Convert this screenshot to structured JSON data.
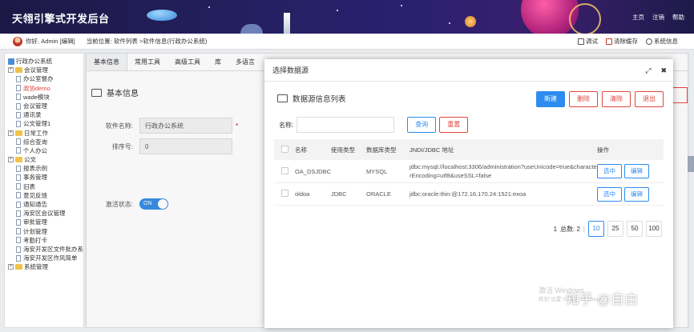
{
  "app": {
    "title": "天翎引擎式开发后台"
  },
  "top_links": [
    "主页",
    "注销",
    "帮助"
  ],
  "crumb": {
    "greeting": "你好, Admin [编辑]",
    "location": "当前位置: 软件列表 >软件信息(行政办公系统)",
    "tools": [
      "调试",
      "清除缓存",
      "系统信息"
    ]
  },
  "sidebar": {
    "root": "行政办公系统",
    "items": [
      {
        "label": "会议管理",
        "type": "folder",
        "level": 1
      },
      {
        "label": "办公室督办",
        "type": "doc",
        "level": 2
      },
      {
        "label": "政协demo",
        "type": "doc",
        "level": 2,
        "active": true
      },
      {
        "label": "wade模块",
        "type": "doc",
        "level": 2
      },
      {
        "label": "会议管理",
        "type": "doc",
        "level": 2
      },
      {
        "label": "通讯录",
        "type": "doc",
        "level": 2
      },
      {
        "label": "公文管理1",
        "type": "doc",
        "level": 2
      },
      {
        "label": "日常工作",
        "type": "folder",
        "level": 1
      },
      {
        "label": "综合查询",
        "type": "doc",
        "level": 2
      },
      {
        "label": "个人办公",
        "type": "doc",
        "level": 2
      },
      {
        "label": "公文",
        "type": "folder",
        "level": 1
      },
      {
        "label": "报表示例",
        "type": "doc",
        "level": 2
      },
      {
        "label": "事务管理",
        "type": "doc",
        "level": 2
      },
      {
        "label": "旧表",
        "type": "doc",
        "level": 2
      },
      {
        "label": "意见反馈",
        "type": "doc",
        "level": 2
      },
      {
        "label": "通知通告",
        "type": "doc",
        "level": 2
      },
      {
        "label": "海安区会议管理",
        "type": "doc",
        "level": 2
      },
      {
        "label": "审批管理",
        "type": "doc",
        "level": 2
      },
      {
        "label": "计划管理",
        "type": "doc",
        "level": 2
      },
      {
        "label": "考勤打卡",
        "type": "doc",
        "level": 2
      },
      {
        "label": "海安开发区文件批办系",
        "type": "doc",
        "level": 2
      },
      {
        "label": "海安开发区作风简单",
        "type": "doc",
        "level": 2
      },
      {
        "label": "系统管理",
        "type": "folder",
        "level": 1
      }
    ]
  },
  "main": {
    "tabs": [
      "基本信息",
      "常用工具",
      "高级工具",
      "库",
      "多语言"
    ],
    "section_title": "基本信息",
    "fields": {
      "name_label": "软件名称:",
      "name_value": "行政办公系统",
      "order_label": "排序号:",
      "order_value": "0",
      "active_label": "激活状态:",
      "active_value": "ON",
      "required_mark": "*"
    }
  },
  "modal": {
    "title": "选择数据源",
    "ctrl_max": "⤢",
    "ctrl_close": "✖",
    "list_title": "数据源信息列表",
    "buttons": {
      "new": "新建",
      "delete": "删除",
      "clear": "清除",
      "exit": "退出"
    },
    "search": {
      "label": "名称:",
      "query": "查询",
      "reset": "重置",
      "value": ""
    },
    "columns": [
      "名称",
      "使用类型",
      "数据库类型",
      "JNDI/JDBC 地址",
      "操作"
    ],
    "rows": [
      {
        "name": "OA_DSJDBC",
        "usage": "",
        "dbtype": "MYSQL",
        "url": "jdbc:mysql://localhost:3306/administration?useUnicode=true&characterEncoding=utf8&useSSL=false",
        "select": "选中",
        "edit": "编辑"
      },
      {
        "name": "oldoa",
        "usage": "JDBC",
        "dbtype": "ORACLE",
        "url": "jdbc:oracle:thin:@172.16.170.24:1521:exoa",
        "select": "选中",
        "edit": "编辑"
      }
    ],
    "pager": {
      "page": "1",
      "total_label": "总数: 2",
      "sizes": [
        "10",
        "25",
        "50",
        "100"
      ],
      "selected_size": "10"
    }
  },
  "watermark": {
    "win1": "激活 Windows",
    "win2": "转到\"设置\"以激活 Windows。",
    "zhihu": "知乎 @自由"
  }
}
